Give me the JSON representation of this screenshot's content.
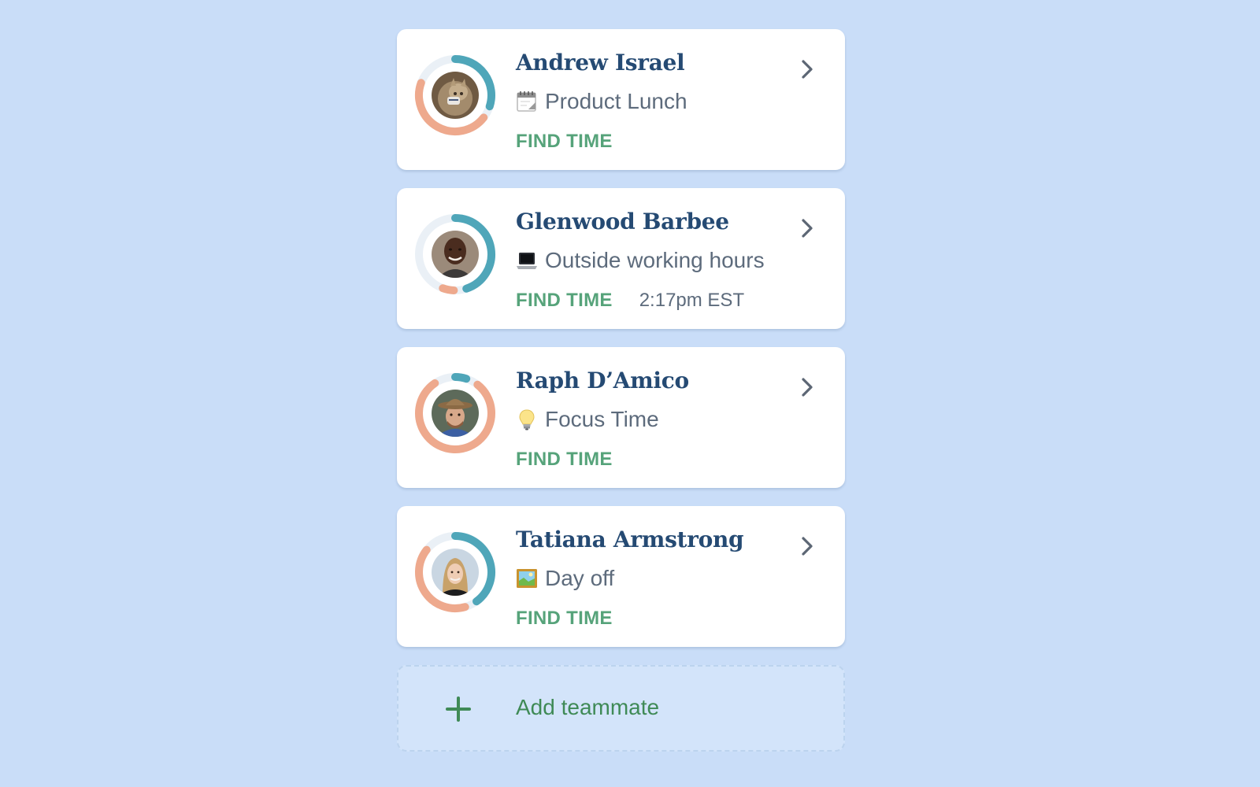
{
  "colors": {
    "background": "#c9ddf8",
    "card": "#ffffff",
    "name": "#254a73",
    "status_text": "#5d6b7c",
    "find_time": "#56a37a",
    "ring_teal": "#4fa6b9",
    "ring_salmon": "#eea98d",
    "add_teammate": "#3f8a56"
  },
  "teammates": [
    {
      "name": "Andrew Israel",
      "status_icon": "calendar-icon",
      "status": "Product Lunch",
      "action": "FIND TIME",
      "local_time": "",
      "ring_teal_fraction": 0.3,
      "ring_salmon_fraction": 0.45
    },
    {
      "name": "Glenwood Barbee",
      "status_icon": "laptop-icon",
      "status": "Outside working hours",
      "action": "FIND TIME",
      "local_time": "2:17pm EST",
      "ring_teal_fraction": 0.45,
      "ring_salmon_fraction": 0.05
    },
    {
      "name": "Raph D’Amico",
      "status_icon": "lightbulb-icon",
      "status": "Focus Time",
      "action": "FIND TIME",
      "local_time": "",
      "ring_teal_fraction": 0.05,
      "ring_salmon_fraction": 0.8
    },
    {
      "name": "Tatiana Armstrong",
      "status_icon": "picture-icon",
      "status": "Day off",
      "action": "FIND TIME",
      "local_time": "",
      "ring_teal_fraction": 0.4,
      "ring_salmon_fraction": 0.4
    }
  ],
  "add_teammate": {
    "label": "Add teammate",
    "icon": "plus-icon"
  }
}
